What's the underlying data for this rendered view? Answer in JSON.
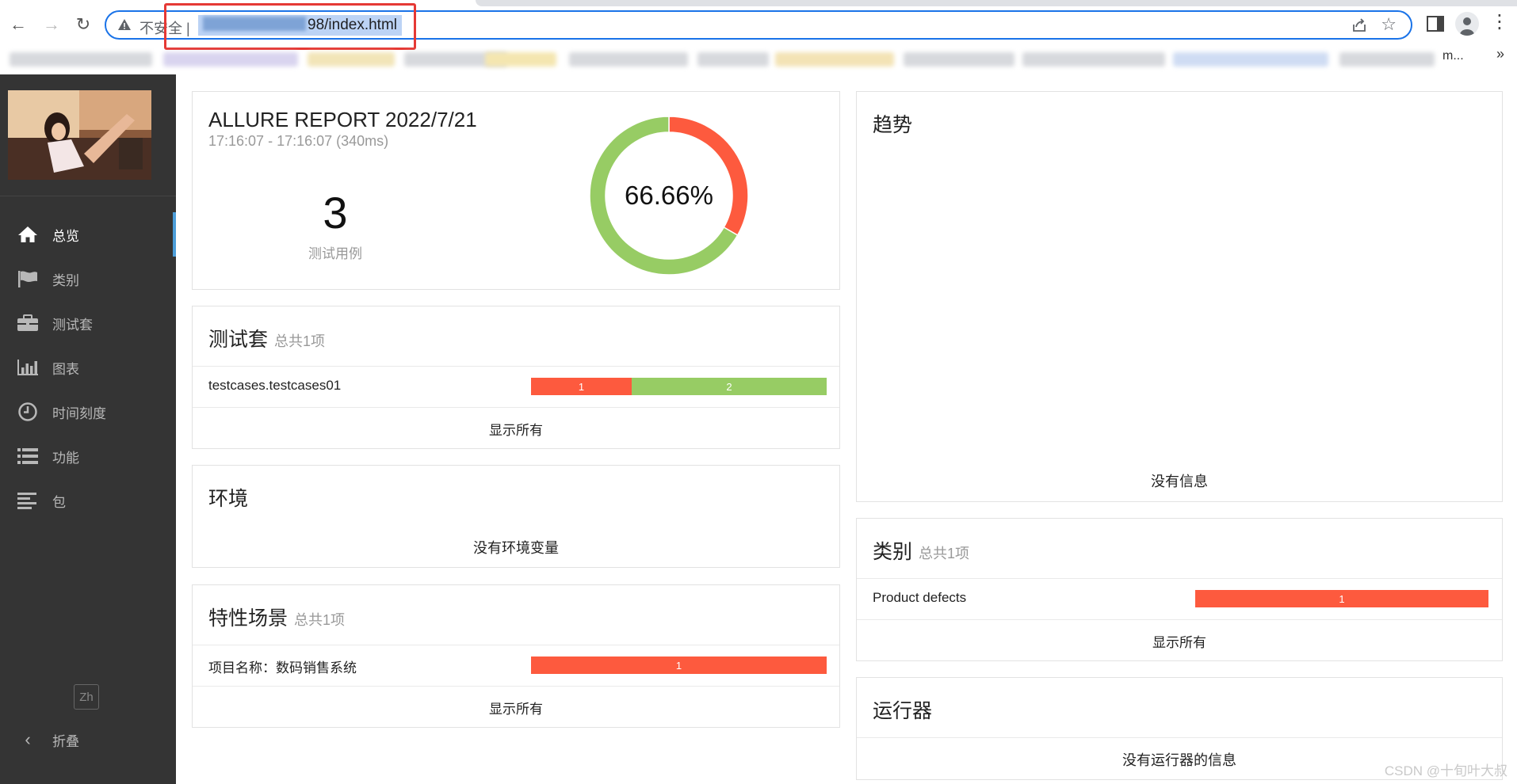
{
  "browser": {
    "insecure_label": "不安全 |",
    "url_visible": "98/index.html",
    "bookmark_tail": "m...",
    "bookmark_more": "»"
  },
  "sidebar": {
    "items": [
      {
        "label": "总览",
        "icon": "home-icon",
        "active": true
      },
      {
        "label": "类别",
        "icon": "flag-icon"
      },
      {
        "label": "测试套",
        "icon": "briefcase-icon"
      },
      {
        "label": "图表",
        "icon": "bar-chart-icon"
      },
      {
        "label": "时间刻度",
        "icon": "clock-icon"
      },
      {
        "label": "功能",
        "icon": "list-icon"
      },
      {
        "label": "包",
        "icon": "align-left-icon"
      }
    ],
    "lang_button": "Zh",
    "collapse_label": "折叠"
  },
  "summary": {
    "title": "ALLURE REPORT 2022/7/21",
    "time": "17:16:07 - 17:16:07 (340ms)",
    "test_count": "3",
    "test_count_label": "测试用例",
    "pass_rate_text": "66.66%"
  },
  "chart_data": {
    "type": "pie",
    "title": "",
    "categories": [
      "failed",
      "passed"
    ],
    "values": [
      1,
      2
    ],
    "colors": [
      "#fd5a3e",
      "#97cc64"
    ],
    "center_label": "66.66%"
  },
  "suites": {
    "title": "测试套",
    "subtitle": "总共1项",
    "rows": [
      {
        "name": "testcases.testcases01",
        "failed": 1,
        "passed": 2
      }
    ],
    "show_all": "显示所有"
  },
  "environment": {
    "title": "环境",
    "empty": "没有环境变量"
  },
  "features": {
    "title": "特性场景",
    "subtitle": "总共1项",
    "rows": [
      {
        "name": "项目名称：数码销售系统",
        "failed": 1,
        "passed": 0
      }
    ],
    "show_all": "显示所有"
  },
  "trend": {
    "title": "趋势",
    "empty": "没有信息"
  },
  "categories": {
    "title": "类别",
    "subtitle": "总共1项",
    "rows": [
      {
        "name": "Product defects",
        "failed": 1
      }
    ],
    "show_all": "显示所有"
  },
  "executors": {
    "title": "运行器",
    "empty": "没有运行器的信息"
  },
  "watermark": "CSDN @十旬叶大叔",
  "colors": {
    "failed": "#fd5a3e",
    "passed": "#97cc64",
    "sidebar_bg": "#343434",
    "active_accent": "#4c9ed9"
  }
}
